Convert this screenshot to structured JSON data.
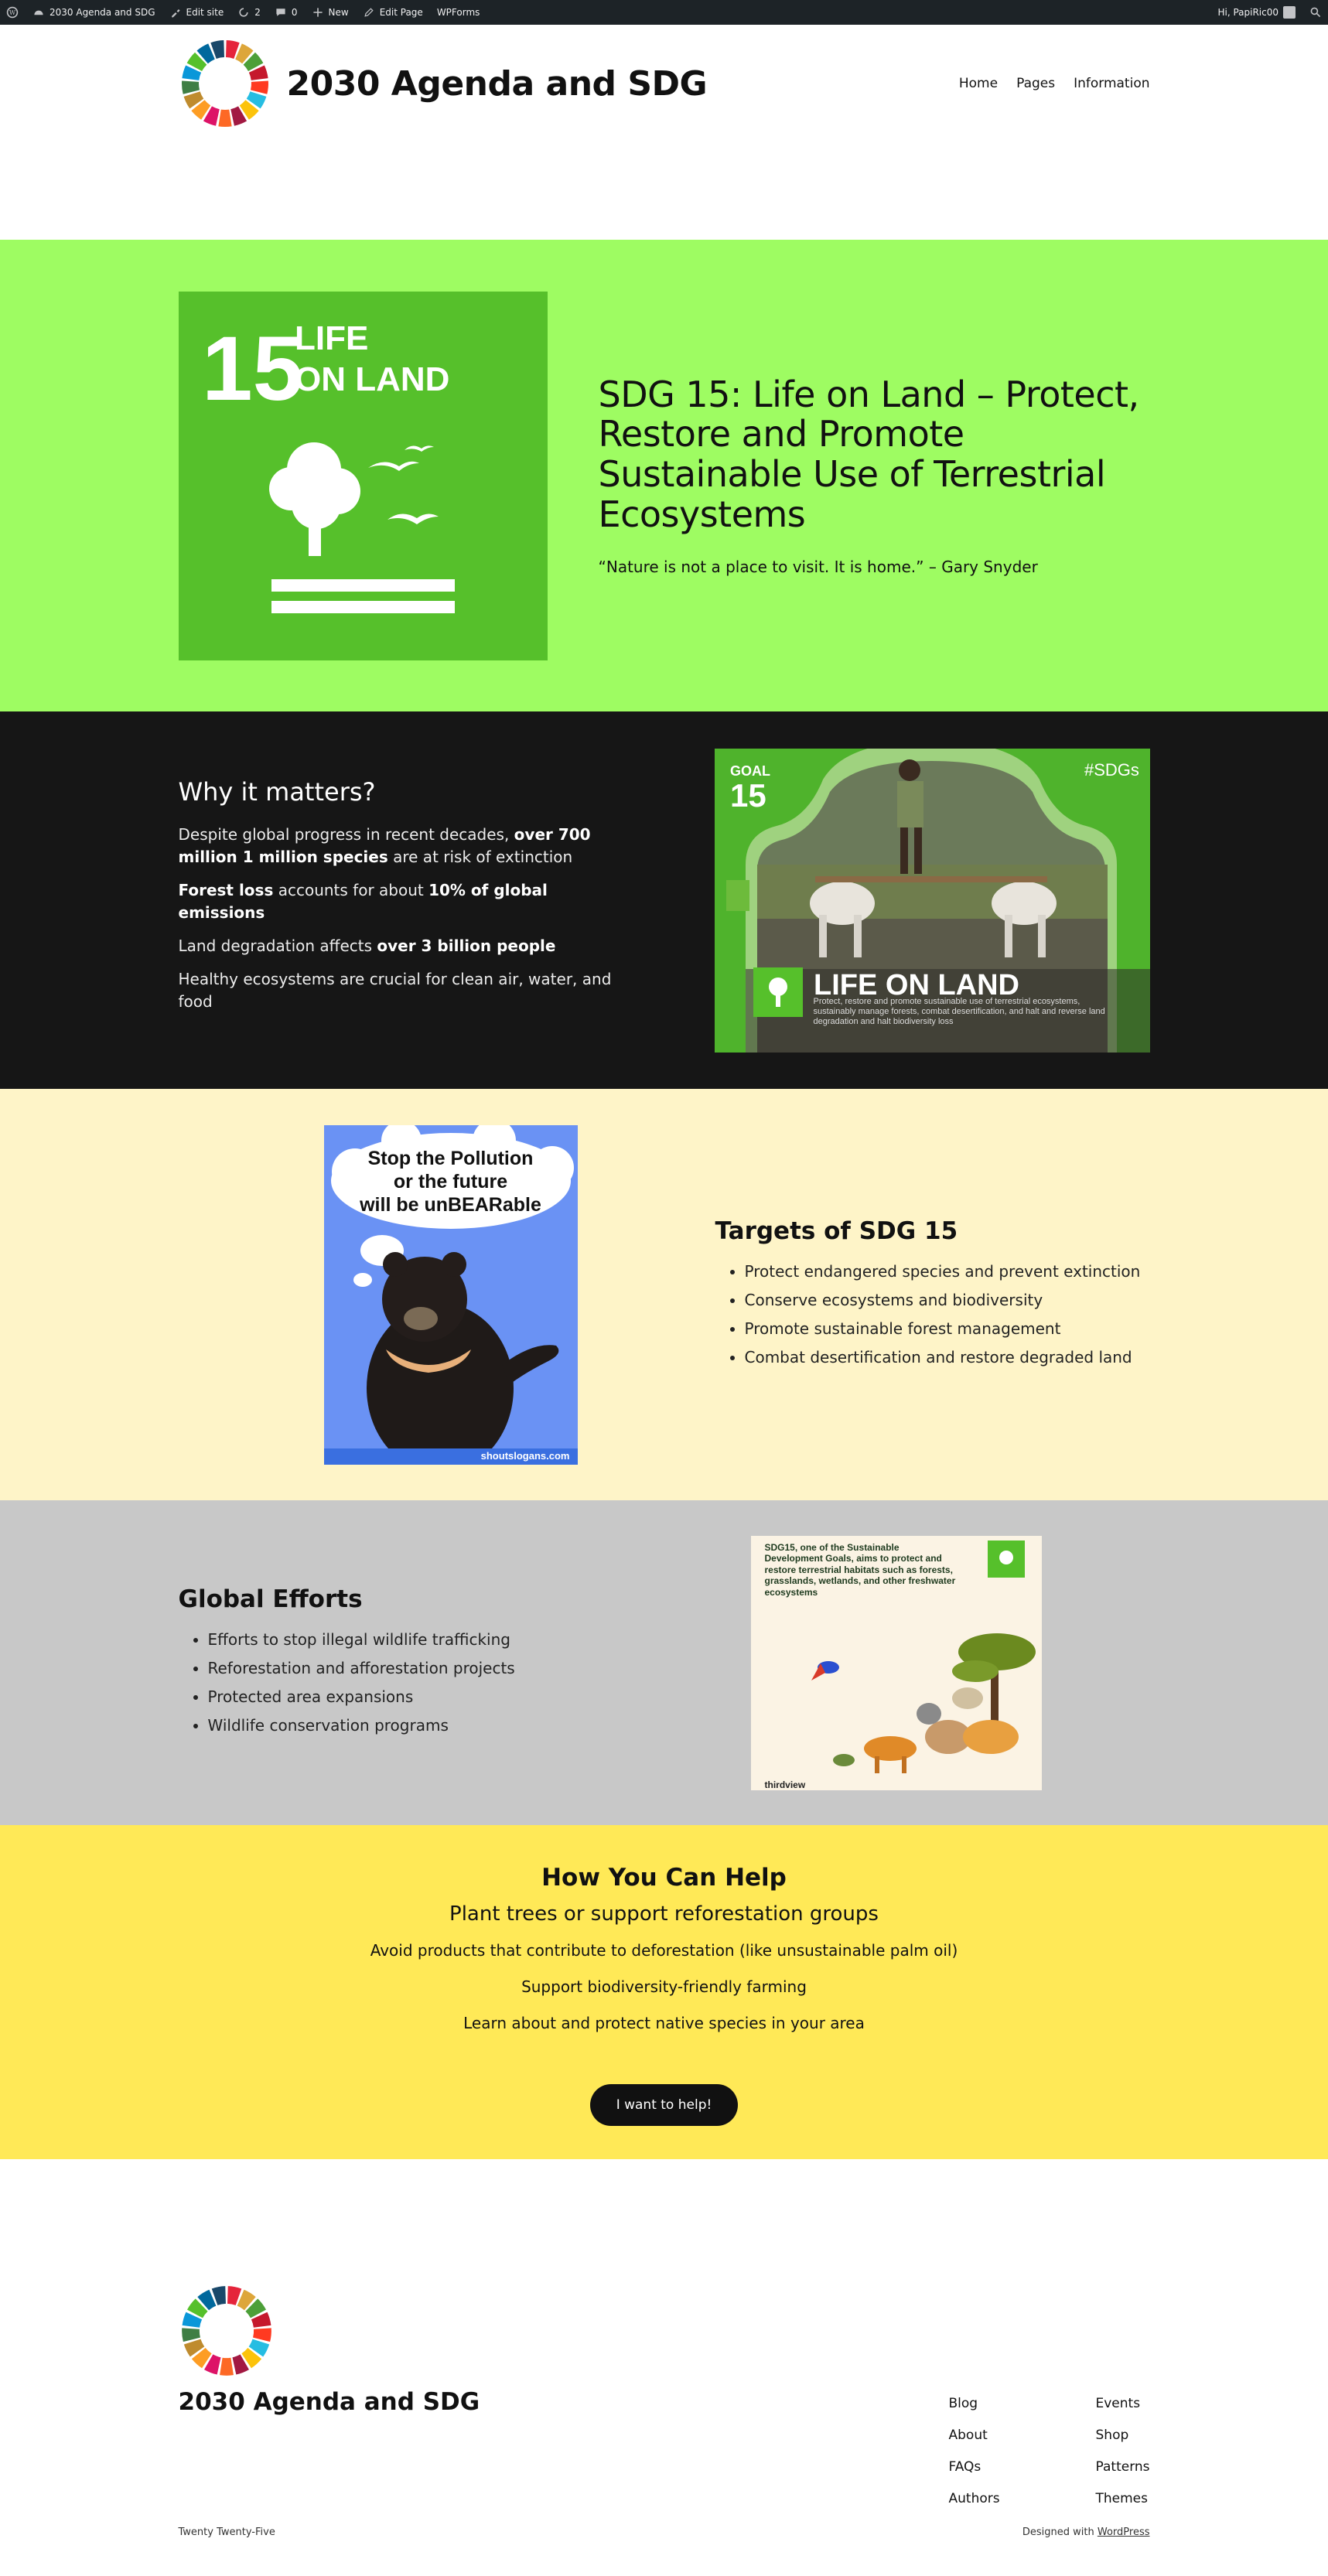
{
  "adminbar": {
    "site_name": "2030 Agenda and SDG",
    "edit_site": "Edit site",
    "updates_count": "2",
    "comments_count": "0",
    "new_label": "New",
    "edit_page": "Edit Page",
    "wpforms": "WPForms",
    "greeting": "Hi, PapiRic00"
  },
  "header": {
    "title": "2030 Agenda and SDG",
    "nav": [
      "Home",
      "Pages",
      "Information"
    ]
  },
  "hero": {
    "tile_number": "15",
    "tile_line1": "LIFE",
    "tile_line2": "ON LAND",
    "title": "SDG 15: Life on Land – Protect, Restore and Promote Sustainable Use of Terrestrial Ecosystems",
    "quote": "“Nature is not a place to visit. It is home.” – Gary Snyder"
  },
  "why": {
    "title": "Why it matters?",
    "p1_a": "Despite global progress in recent decades, ",
    "p1_b": "over 700 million 1 million species",
    "p1_c": " are at risk of extinction",
    "p2_a": "Forest loss",
    "p2_b": " accounts for about ",
    "p2_c": "10% of global emissions",
    "p3_a": "Land degradation affects ",
    "p3_b": "over 3 billion people",
    "p4": "Healthy ecosystems are crucial for clean air, water, and food",
    "card": {
      "goal_label": "GOAL",
      "goal_number": "15",
      "hashtag": "#SDGs",
      "headline": "LIFE ON LAND",
      "caption": "Protect, restore and promote sustainable use of terrestrial ecosystems, sustainably manage forests, combat desertification, and halt and reverse land degradation and halt biodiversity loss"
    }
  },
  "targets": {
    "poster_line1": "Stop the Pollution",
    "poster_line2": "or the future",
    "poster_line3": "will be unBEARable",
    "poster_credit": "shoutslogans.com",
    "title": "Targets of SDG 15",
    "items": [
      "Protect endangered species and prevent extinction",
      "Conserve ecosystems and biodiversity",
      "Promote sustainable forest management",
      "Combat desertification and restore degraded land"
    ]
  },
  "global": {
    "title": "Global Efforts",
    "items": [
      "Efforts to stop illegal wildlife trafficking",
      "Reforestation and afforestation projects",
      "Protected area expansions",
      "Wildlife conservation programs"
    ],
    "card_text": "SDG15, one of the Sustainable Development Goals, aims to protect and restore terrestrial habitats such as forests, grasslands, wetlands, and other freshwater ecosystems",
    "card_brand": "thirdview"
  },
  "help": {
    "title": "How You Can Help",
    "subtitle": "Plant trees or support reforestation groups",
    "items": [
      "Avoid products that contribute to deforestation (like unsustainable palm oil)",
      "Support biodiversity-friendly farming",
      "Learn about and protect native species in your area"
    ],
    "button": "I want to help!"
  },
  "footer": {
    "title": "2030 Agenda and SDG",
    "col1": [
      "Blog",
      "About",
      "FAQs",
      "Authors"
    ],
    "col2": [
      "Events",
      "Shop",
      "Patterns",
      "Themes"
    ],
    "theme": "Twenty Twenty-Five",
    "designed_prefix": "Designed with ",
    "designed_link": "WordPress"
  },
  "colors": {
    "adminbar": "#1d2327",
    "hero_bg": "#9efc62",
    "sdg15_green": "#56c02b",
    "why_bg": "#161616",
    "targets_bg": "#fef4c8",
    "global_bg": "#c8c8c8",
    "help_bg": "#ffe957"
  }
}
